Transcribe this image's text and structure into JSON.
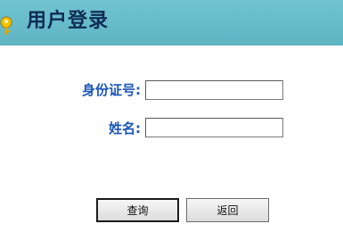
{
  "header": {
    "title": "用户登录",
    "icon": "key-icon"
  },
  "form": {
    "id_number_label": "身份证号:",
    "id_number_value": "",
    "name_label": "姓名:",
    "name_value": ""
  },
  "buttons": {
    "query_label": "查询",
    "back_label": "返回"
  },
  "colors": {
    "header_bg": "#66bac8",
    "title_text": "#0f2c55",
    "label_text": "#1a55b8",
    "icon": "#e6b400"
  }
}
